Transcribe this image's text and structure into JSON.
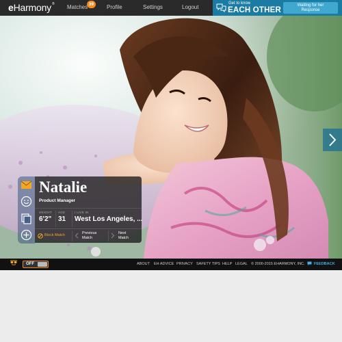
{
  "header": {
    "logo_e": "e",
    "logo_rest": "Harmony",
    "logo_tm": "®",
    "nav": [
      {
        "label": "Matches"
      },
      {
        "label": "Profile"
      },
      {
        "label": "Settings"
      },
      {
        "label": "Logout"
      }
    ],
    "matches_badge": "39",
    "cta_small": "Get to know",
    "cta_big": "EACH OTHER",
    "waiting_line1": "Waiting for her",
    "waiting_line2": "Response",
    "icons": {
      "chat": "chat-bubbles-icon"
    }
  },
  "profile": {
    "name": "Natalie",
    "job": "Product Manager",
    "height_label": "HEIGHT",
    "height": "6'2\"",
    "age_label": "AGE",
    "age": "31",
    "live_label": "I LIVE IN",
    "location": "West Los Angeles, ...",
    "block_label": "Block Match",
    "prev_label_1": "Previous",
    "prev_label_2": "Match",
    "next_label_1": "Next",
    "next_label_2": "Match"
  },
  "sidebar": {
    "icons": [
      "envelope-icon",
      "smile-icon",
      "copy-icon",
      "plus-icon"
    ]
  },
  "footer": {
    "toggle_label": "OFF",
    "links": [
      "ABOUT",
      "EH ADVICE",
      "PRIVACY",
      "SAFETY TIPS",
      "HELP",
      "LEGAL",
      "© 2000-2015 EHARMONY, INC."
    ],
    "feedback": "FEEDBACK"
  },
  "colors": {
    "accent_orange": "#f28c1e",
    "accent_blue": "#1b7ca3",
    "button_blue": "#3fa7d0",
    "block_orange": "#f5a623",
    "topbar": "#2a2a2a",
    "footer": "#111111"
  }
}
